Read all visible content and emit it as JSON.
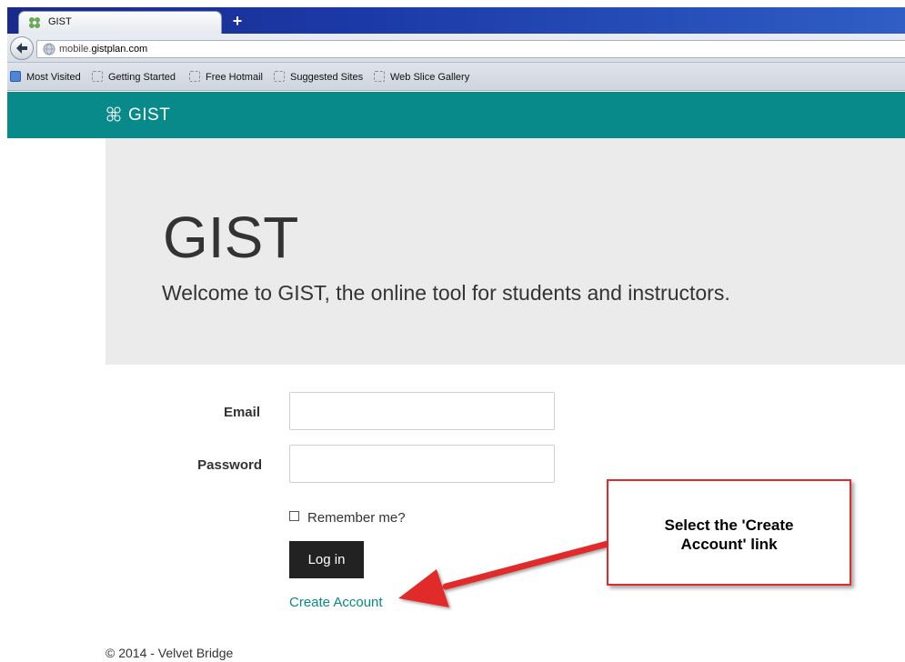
{
  "browser": {
    "tab_title": "GIST",
    "new_tab_glyph": "+",
    "url_prefix": "mobile.",
    "url_domain": "gistplan.com",
    "bookmarks": [
      "Most Visited",
      "Getting Started",
      "Free Hotmail",
      "Suggested Sites",
      "Web Slice Gallery"
    ]
  },
  "header": {
    "brand": "GIST",
    "bg_color": "#08898a"
  },
  "hero": {
    "title": "GIST",
    "lead": "Welcome to GIST, the online tool for students and instructors."
  },
  "login_form": {
    "email_label": "Email",
    "email_value": "",
    "password_label": "Password",
    "password_value": "",
    "remember_label": "Remember me?",
    "remember_checked": false,
    "login_button": "Log in",
    "create_account_link": "Create Account"
  },
  "footer": {
    "text": "© 2014 - Velvet Bridge"
  },
  "annotation": {
    "text_line1": "Select the 'Create",
    "text_line2": "Account' link",
    "color": "#e12a2a"
  }
}
